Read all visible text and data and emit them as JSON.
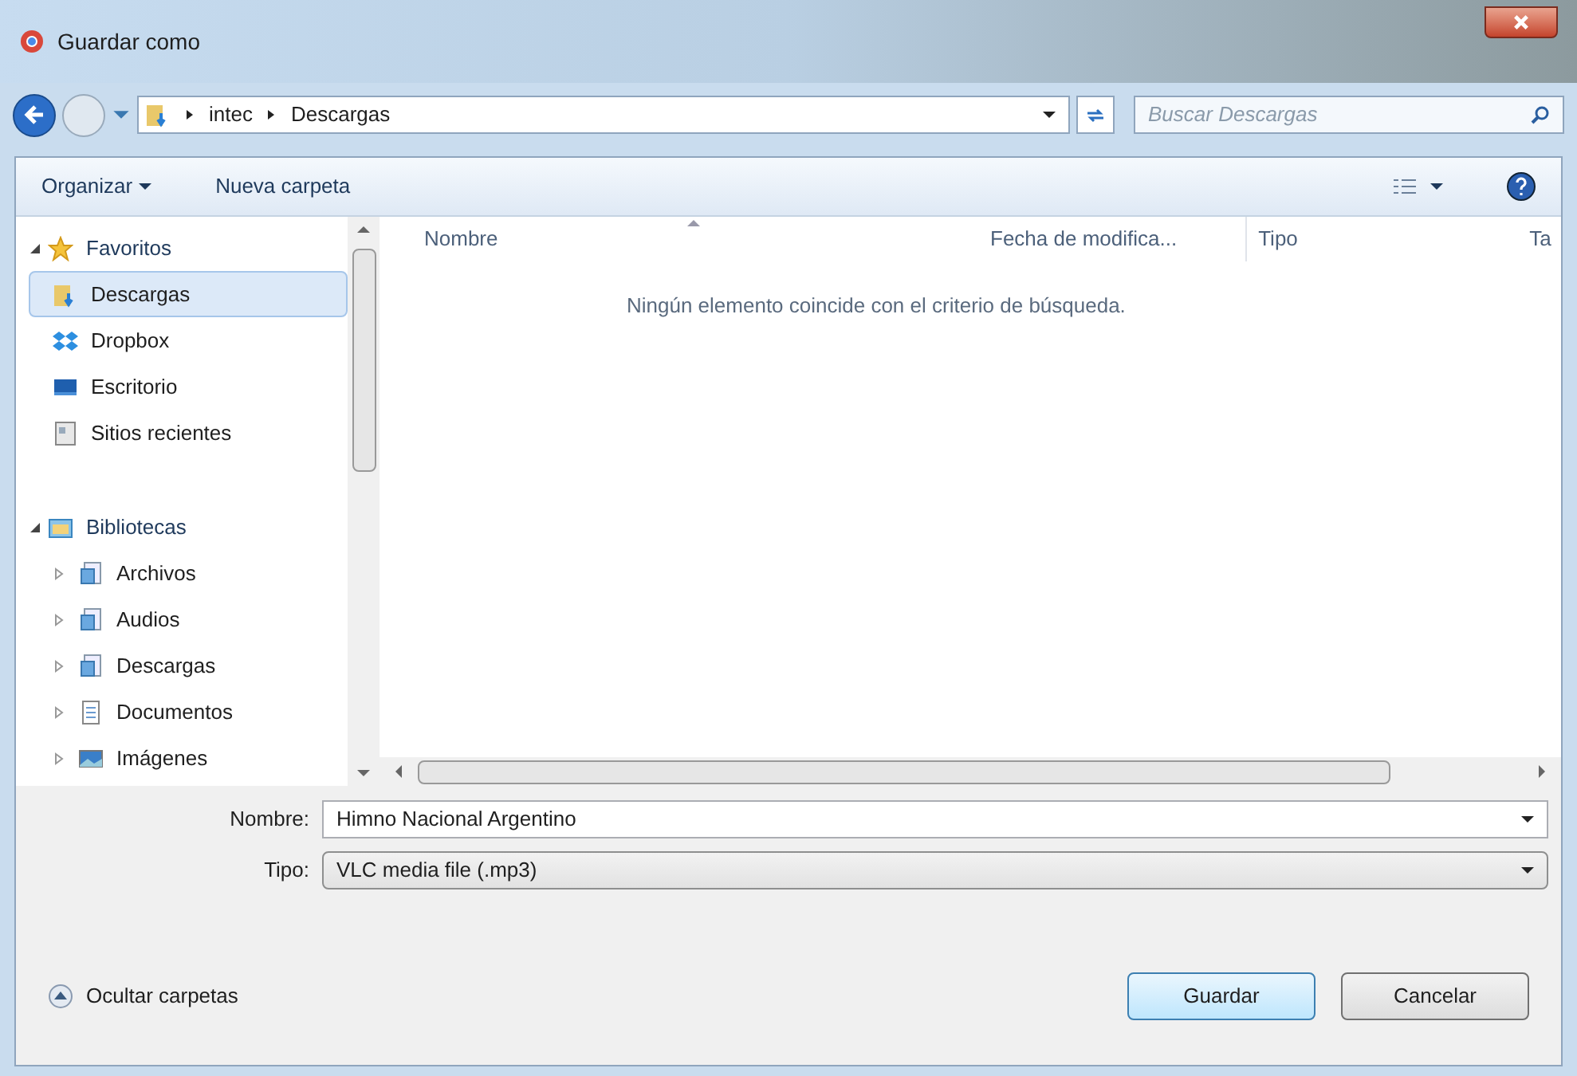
{
  "window": {
    "title": "Guardar como"
  },
  "address": {
    "path": [
      "intec",
      "Descargas"
    ],
    "search_placeholder": "Buscar Descargas"
  },
  "toolbar": {
    "organize": "Organizar",
    "new_folder": "Nueva carpeta"
  },
  "sidebar": {
    "groups": [
      {
        "label": "Favoritos",
        "expanded": true,
        "kind": "star",
        "children": [
          {
            "label": "Descargas",
            "selected": true,
            "kind": "downloads"
          },
          {
            "label": "Dropbox",
            "selected": false,
            "kind": "dropbox"
          },
          {
            "label": "Escritorio",
            "selected": false,
            "kind": "desktop"
          },
          {
            "label": "Sitios recientes",
            "selected": false,
            "kind": "recent"
          }
        ]
      },
      {
        "label": "Bibliotecas",
        "expanded": true,
        "kind": "library",
        "children": [
          {
            "label": "Archivos",
            "selected": false,
            "kind": "lib"
          },
          {
            "label": "Audios",
            "selected": false,
            "kind": "lib"
          },
          {
            "label": "Descargas",
            "selected": false,
            "kind": "lib"
          },
          {
            "label": "Documentos",
            "selected": false,
            "kind": "doc"
          },
          {
            "label": "Imágenes",
            "selected": false,
            "kind": "pictures"
          }
        ]
      }
    ]
  },
  "table": {
    "columns": [
      "Nombre",
      "Fecha de modifica...",
      "Tipo",
      "Ta"
    ],
    "empty_message": "Ningún elemento coincide con el criterio de búsqueda."
  },
  "form": {
    "name_label": "Nombre:",
    "name_value": "Himno Nacional Argentino",
    "type_label": "Tipo:",
    "type_value": "VLC media file (.mp3)"
  },
  "footer": {
    "hide_folders": "Ocultar carpetas",
    "buttons": [
      {
        "label": "Guardar",
        "kind": "primary"
      },
      {
        "label": "Cancelar",
        "kind": "normal"
      }
    ]
  }
}
